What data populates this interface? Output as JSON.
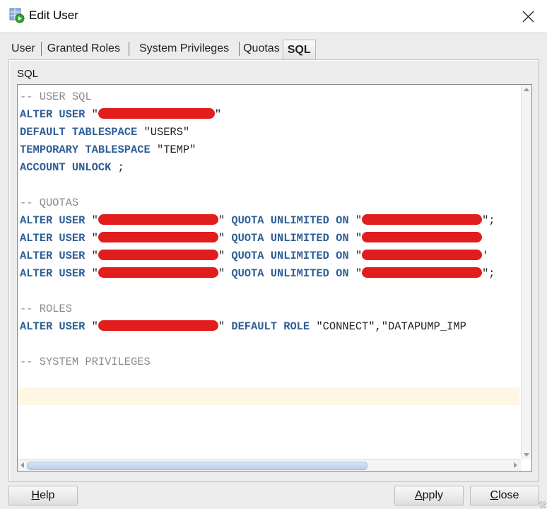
{
  "window": {
    "title": "Edit User",
    "icon": "edit-user-icon",
    "close_icon": "close-icon"
  },
  "tabs": [
    {
      "label": "User",
      "active": false
    },
    {
      "label": "Granted Roles",
      "active": false
    },
    {
      "label": "System Privileges",
      "active": false
    },
    {
      "label": "Quotas",
      "active": false
    },
    {
      "label": "SQL",
      "active": true
    }
  ],
  "panel": {
    "label": "SQL"
  },
  "editor": {
    "lines": [
      {
        "type": "comment",
        "text": "-- USER SQL"
      },
      {
        "type": "code",
        "parts": [
          {
            "k": "ALTER USER"
          },
          {
            "s": " \""
          },
          {
            "r": "redacted"
          },
          {
            "s": "\""
          }
        ]
      },
      {
        "type": "code",
        "parts": [
          {
            "k": "DEFAULT TABLESPACE"
          },
          {
            "s": " \"USERS\""
          }
        ]
      },
      {
        "type": "code",
        "parts": [
          {
            "k": "TEMPORARY TABLESPACE"
          },
          {
            "s": " \"TEMP\""
          }
        ]
      },
      {
        "type": "code",
        "parts": [
          {
            "k": "ACCOUNT UNLOCK"
          },
          {
            "s": " ;"
          }
        ]
      },
      {
        "type": "blank",
        "text": ""
      },
      {
        "type": "comment",
        "text": "-- QUOTAS"
      },
      {
        "type": "code",
        "parts": [
          {
            "k": "ALTER USER"
          },
          {
            "s": " \""
          },
          {
            "r": "redacted"
          },
          {
            "s": "\" "
          },
          {
            "k": "QUOTA UNLIMITED ON"
          },
          {
            "s": " \""
          },
          {
            "r": "redacted"
          },
          {
            "s": "\";"
          }
        ]
      },
      {
        "type": "code",
        "parts": [
          {
            "k": "ALTER USER"
          },
          {
            "s": " \""
          },
          {
            "r": "redacted"
          },
          {
            "s": "\" "
          },
          {
            "k": "QUOTA UNLIMITED ON"
          },
          {
            "s": " \""
          },
          {
            "r": "redacted"
          }
        ]
      },
      {
        "type": "code",
        "parts": [
          {
            "k": "ALTER USER"
          },
          {
            "s": " \""
          },
          {
            "r": "redacted"
          },
          {
            "s": "\" "
          },
          {
            "k": "QUOTA UNLIMITED ON"
          },
          {
            "s": " \""
          },
          {
            "r": "redacted"
          },
          {
            "s": "'"
          }
        ]
      },
      {
        "type": "code",
        "parts": [
          {
            "k": "ALTER USER"
          },
          {
            "s": " \""
          },
          {
            "r": "redacted"
          },
          {
            "s": "\" "
          },
          {
            "k": "QUOTA UNLIMITED ON"
          },
          {
            "s": " \""
          },
          {
            "r": "redacted"
          },
          {
            "s": "\";"
          }
        ]
      },
      {
        "type": "blank",
        "text": ""
      },
      {
        "type": "comment",
        "text": "-- ROLES"
      },
      {
        "type": "code",
        "parts": [
          {
            "k": "ALTER USER"
          },
          {
            "s": " \""
          },
          {
            "r": "redacted"
          },
          {
            "s": "\" "
          },
          {
            "k": "DEFAULT ROLE"
          },
          {
            "s": " \"CONNECT\",\"DATAPUMP_IMP"
          }
        ]
      },
      {
        "type": "blank",
        "text": ""
      },
      {
        "type": "comment",
        "text": "-- SYSTEM PRIVILEGES"
      }
    ]
  },
  "buttons": {
    "help": {
      "mnemonic": "H",
      "rest": "elp"
    },
    "apply": {
      "mnemonic": "A",
      "rest": "pply"
    },
    "close": {
      "mnemonic": "C",
      "rest": "lose"
    }
  },
  "colors": {
    "keyword": "#2e5f96",
    "comment": "#8a8a8a",
    "redaction": "#e21d1d",
    "current_line": "#fff7e3",
    "scroll_thumb": "#b8cde6"
  }
}
